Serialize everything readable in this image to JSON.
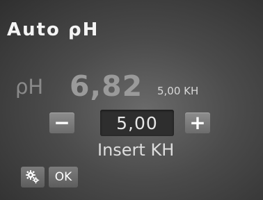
{
  "screen": {
    "title": "Auto ρH",
    "ph_label": "ρH",
    "ph_value": "6,82",
    "kh_reading": "5,00 KH"
  },
  "stepper": {
    "minus_label": "−",
    "value": "5,00",
    "plus_label": "+"
  },
  "instruction": "Insert KH",
  "buttons": {
    "settings_icon": "gears-icon",
    "ok_label": "OK"
  }
}
